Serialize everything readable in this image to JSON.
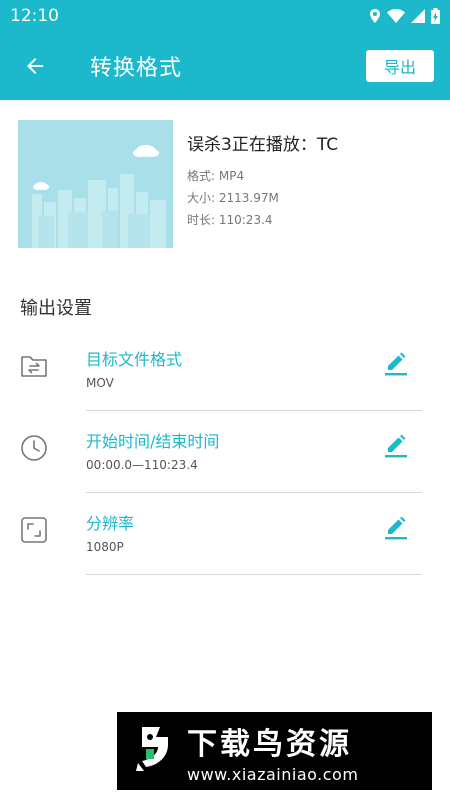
{
  "status_bar": {
    "time": "12:10"
  },
  "app_bar": {
    "title": "转换格式",
    "export_label": "导出"
  },
  "file": {
    "name": "误杀3正在播放：TC",
    "format": "格式: MP4",
    "size": "大小: 2113.97M",
    "duration": "时长: 110:23.4"
  },
  "output": {
    "section_title": "输出设置",
    "settings": [
      {
        "title": "目标文件格式",
        "value": "MOV"
      },
      {
        "title": "开始时间/结束时间",
        "value": "00:00.0—110:23.4"
      },
      {
        "title": "分辨率",
        "value": "1080P"
      }
    ]
  },
  "watermark": {
    "title": "下载鸟资源",
    "url": "www.xiazainiao.com"
  },
  "colors": {
    "accent": "#1cb8cc",
    "thumbnail": "#a8dfe8"
  }
}
